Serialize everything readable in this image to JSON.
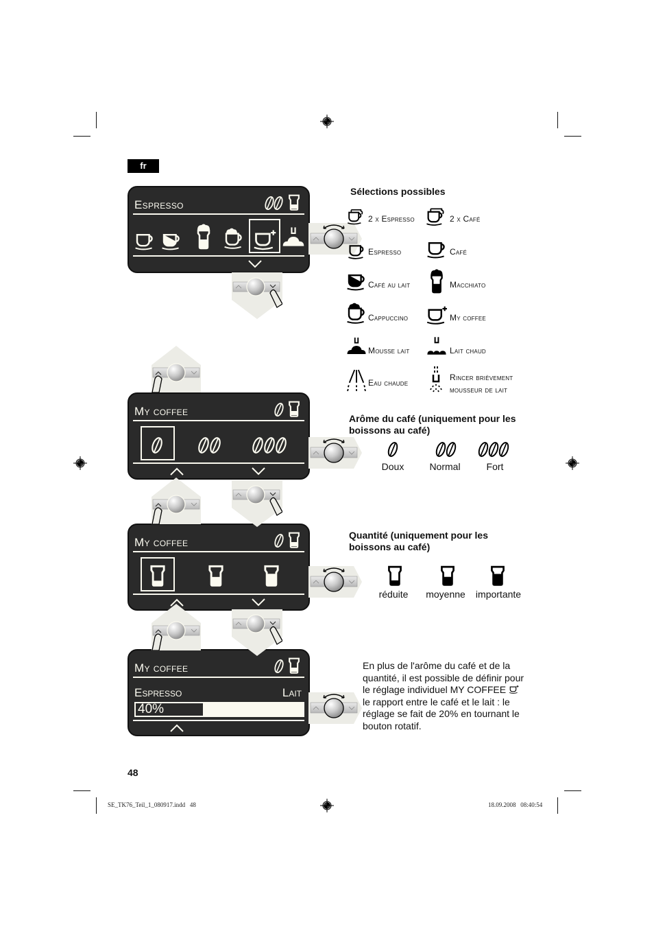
{
  "language_tab": "fr",
  "page_number": "48",
  "footer": {
    "file_slug": "SE_TK76_Teil_1_080917.indd   48",
    "timestamp": "18.09.2008   08:40:54"
  },
  "screens": [
    {
      "title": "Espresso",
      "status_icons": [
        "two-beans-icon",
        "cup-level-icon"
      ],
      "options": [
        "espresso-cup-icon",
        "cafe-au-lait-icon",
        "macchiato-icon",
        "cappuccino-icon",
        "my-coffee-icon",
        "milk-foam-icon"
      ],
      "selected_index": 4,
      "nav": [
        "down"
      ]
    },
    {
      "title": "My coffee",
      "status_icons": [
        "one-bean-icon",
        "cup-level-icon"
      ],
      "options": [
        "one-bean-icon",
        "two-beans-icon",
        "three-beans-icon"
      ],
      "selected_index": 0,
      "nav": [
        "up",
        "down"
      ]
    },
    {
      "title": "My coffee",
      "status_icons": [
        "one-bean-icon",
        "cup-level-icon"
      ],
      "options": [
        "cup-small-icon",
        "cup-medium-icon",
        "cup-large-icon"
      ],
      "selected_index": 0,
      "nav": [
        "up",
        "down"
      ]
    },
    {
      "title": "My coffee",
      "status_icons": [
        "one-bean-icon",
        "cup-level-icon"
      ],
      "ratio_left_label": "Espresso",
      "ratio_right_label": "Lait",
      "ratio_value_text": "40%",
      "ratio_value": 0.4,
      "nav": [
        "up"
      ]
    }
  ],
  "selections": {
    "heading": "Sélections possibles",
    "items": [
      {
        "icon": "two-espresso-icon",
        "label": "2 x Espresso"
      },
      {
        "icon": "two-cafe-icon",
        "label": "2 x Café"
      },
      {
        "icon": "espresso-icon",
        "label": "Espresso"
      },
      {
        "icon": "cafe-icon",
        "label": "Café"
      },
      {
        "icon": "cafe-au-lait-icon",
        "label": "Café au lait"
      },
      {
        "icon": "macchiato-icon",
        "label": "Macchiato"
      },
      {
        "icon": "cappuccino-icon",
        "label": "Cappuccino"
      },
      {
        "icon": "my-coffee-icon",
        "label": "My coffee"
      },
      {
        "icon": "milk-foam-icon",
        "label": "Mousse lait"
      },
      {
        "icon": "hot-milk-icon",
        "label": "Lait chaud"
      },
      {
        "icon": "hot-water-icon",
        "label": "Eau chaude"
      },
      {
        "icon": "rinse-frother-icon",
        "label": "Rincer brièvement",
        "label2": "mousseur de lait"
      }
    ]
  },
  "aroma": {
    "heading_line1": "Arôme du café (uniquement pour les",
    "heading_line2": "boissons au café)",
    "levels": [
      {
        "label": "Doux",
        "beans": 1
      },
      {
        "label": "Normal",
        "beans": 2
      },
      {
        "label": "Fort",
        "beans": 3
      }
    ]
  },
  "quantity": {
    "heading_line1": "Quantité (uniquement pour les",
    "heading_line2": "boissons au café)",
    "levels": [
      {
        "label": "réduite",
        "fill": 0.35
      },
      {
        "label": "moyenne",
        "fill": 0.65
      },
      {
        "label": "importante",
        "fill": 0.9
      }
    ]
  },
  "ratio_note": {
    "lines": [
      "En plus de l'arôme du café et de la",
      "quantité, il est possible de définir pour",
      "le réglage individuel MY COFFEE",
      "le rapport entre le café et le lait : le",
      "réglage se fait de 20% en tournant le",
      "bouton rotatif."
    ]
  }
}
